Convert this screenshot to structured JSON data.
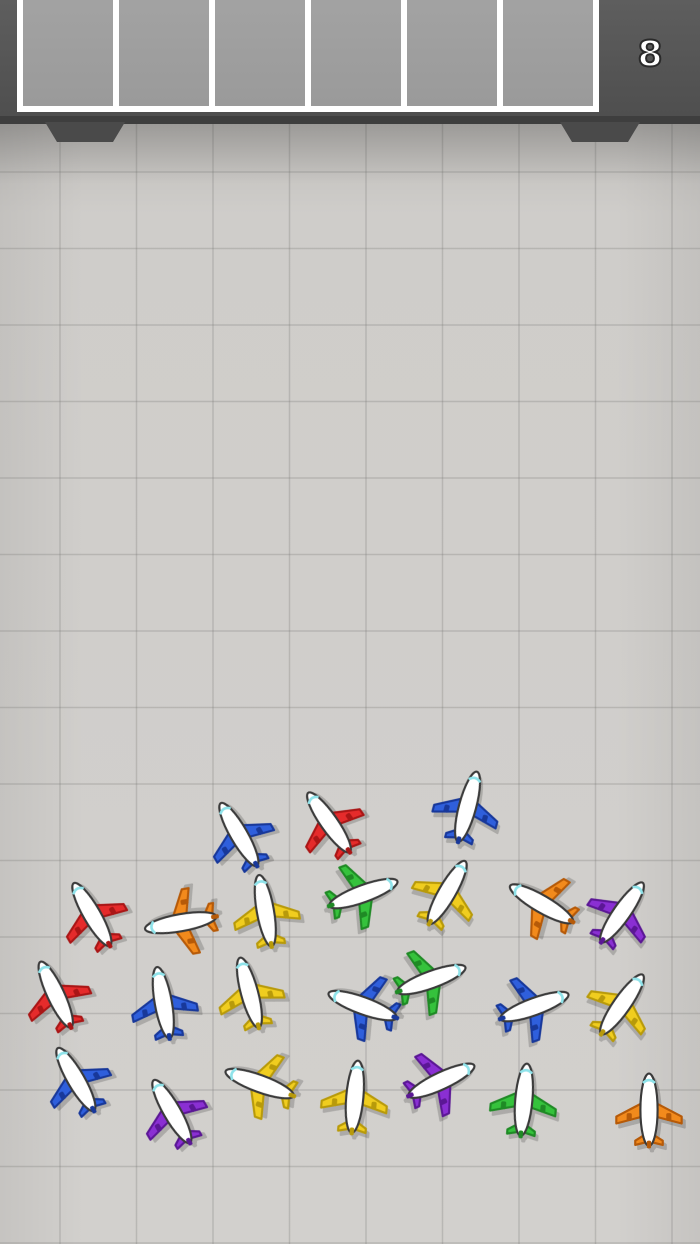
{
  "hud": {
    "level_number": "8",
    "slot_count": 6
  },
  "colors": {
    "red": [
      "#e52b2b",
      "#a91616"
    ],
    "blue": [
      "#2f5fdc",
      "#18389a"
    ],
    "orange": [
      "#f28a1c",
      "#b65a08"
    ],
    "yellow": [
      "#f0cd1f",
      "#b89a0a"
    ],
    "green": [
      "#35c23c",
      "#1f8a25"
    ],
    "purple": [
      "#8a2fd3",
      "#5b1795"
    ]
  },
  "planes": [
    {
      "color": "blue",
      "rotation": -30
    },
    {
      "color": "red",
      "rotation": -35
    },
    {
      "color": "blue",
      "rotation": 15
    },
    {
      "color": "red",
      "rotation": -30
    },
    {
      "color": "orange",
      "rotation": -100
    },
    {
      "color": "yellow",
      "rotation": -10
    },
    {
      "color": "green",
      "rotation": 70
    },
    {
      "color": "yellow",
      "rotation": 30
    },
    {
      "color": "orange",
      "rotation": -60
    },
    {
      "color": "purple",
      "rotation": 35
    },
    {
      "color": "red",
      "rotation": -25
    },
    {
      "color": "blue",
      "rotation": -10
    },
    {
      "color": "yellow",
      "rotation": -15
    },
    {
      "color": "blue",
      "rotation": -70
    },
    {
      "color": "green",
      "rotation": 70
    },
    {
      "color": "blue",
      "rotation": 70
    },
    {
      "color": "yellow",
      "rotation": 35
    },
    {
      "color": "blue",
      "rotation": -30
    },
    {
      "color": "purple",
      "rotation": -30
    },
    {
      "color": "yellow",
      "rotation": -70
    },
    {
      "color": "yellow",
      "rotation": 5
    },
    {
      "color": "purple",
      "rotation": 65
    },
    {
      "color": "green",
      "rotation": 5
    },
    {
      "color": "orange",
      "rotation": 0
    }
  ]
}
